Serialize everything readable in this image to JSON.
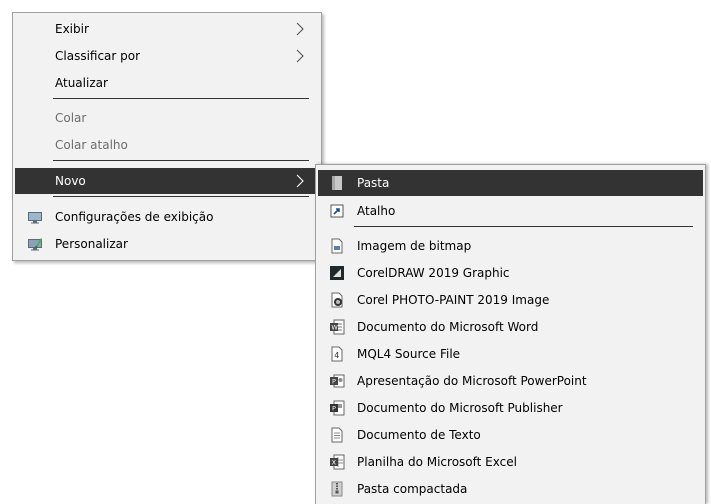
{
  "main_menu": {
    "exibir": "Exibir",
    "classificar": "Classificar por",
    "atualizar": "Atualizar",
    "colar": "Colar",
    "colar_atalho": "Colar atalho",
    "novo": "Novo",
    "configuracoes": "Configurações de exibição",
    "personalizar": "Personalizar"
  },
  "submenu": {
    "pasta": "Pasta",
    "atalho": "Atalho",
    "bitmap": "Imagem de bitmap",
    "coreldraw": "CorelDRAW 2019 Graphic",
    "photopaint": "Corel PHOTO-PAINT 2019 Image",
    "word": "Documento do Microsoft Word",
    "mql4": "MQL4 Source File",
    "powerpoint": "Apresentação do Microsoft PowerPoint",
    "publisher": "Documento do Microsoft Publisher",
    "texto": "Documento de Texto",
    "excel": "Planilha do Microsoft Excel",
    "compactada": "Pasta compactada"
  },
  "icons": {
    "submenu_arrow": "chevron-right-icon",
    "configuracoes": "display-settings-icon",
    "personalizar": "personalize-icon",
    "pasta": "folder-icon",
    "atalho": "shortcut-icon",
    "bitmap": "bitmap-image-icon",
    "coreldraw": "coreldraw-icon",
    "photopaint": "photo-paint-icon",
    "word": "word-document-icon",
    "mql4": "mql4-file-icon",
    "powerpoint": "powerpoint-icon",
    "publisher": "publisher-icon",
    "texto": "text-document-icon",
    "excel": "excel-icon",
    "compactada": "zip-folder-icon"
  },
  "colors": {
    "menu_background": "#f2f2f2",
    "highlight_background": "#333333",
    "highlight_text": "#ffffff",
    "disabled_text": "#6d6d6d",
    "separator": "#333333"
  }
}
